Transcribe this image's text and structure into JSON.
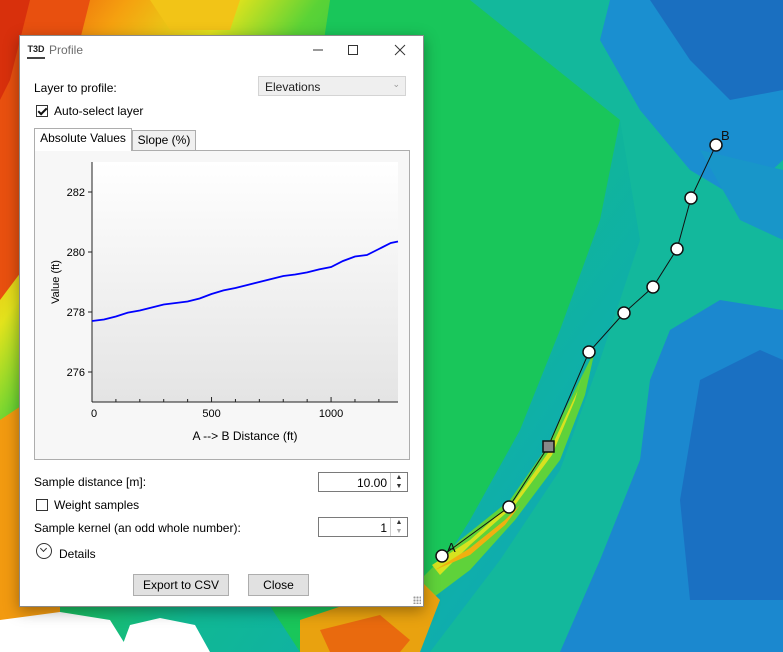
{
  "dialog": {
    "title": "Profile",
    "app_icon_text": "T3D",
    "layer_label": "Layer to profile:",
    "layer_value": "Elevations",
    "auto_select_label": "Auto-select layer",
    "auto_select_checked": true,
    "tabs": [
      {
        "label": "Absolute Values",
        "active": true
      },
      {
        "label": "Slope (%)",
        "active": false
      }
    ],
    "sample_distance_label": "Sample distance [m]:",
    "sample_distance_value": "10.00",
    "weight_samples_label": "Weight samples",
    "weight_samples_checked": false,
    "kernel_label": "Sample kernel (an odd whole number):",
    "kernel_value": "1",
    "details_label": "Details",
    "export_button": "Export to CSV",
    "close_button": "Close"
  },
  "map": {
    "point_a_label": "A",
    "point_b_label": "B",
    "colors": {
      "low_blue": "#1a7fd6",
      "teal": "#14b7a0",
      "green": "#21c640",
      "yellow": "#d9e21c",
      "orange": "#f2a10d",
      "red": "#e5410d"
    }
  },
  "chart_data": {
    "type": "line",
    "xlabel": "A --> B Distance (ft)",
    "ylabel": "Value (ft)",
    "xlim": [
      0,
      1280
    ],
    "ylim": [
      275,
      283
    ],
    "x_ticks": [
      0,
      500,
      1000
    ],
    "y_ticks": [
      276,
      278,
      280,
      282
    ],
    "series": [
      {
        "color": "#0000ff",
        "x": [
          0,
          50,
          100,
          150,
          200,
          250,
          300,
          350,
          400,
          450,
          500,
          550,
          600,
          650,
          700,
          750,
          800,
          850,
          900,
          950,
          1000,
          1050,
          1100,
          1150,
          1200,
          1250,
          1280
        ],
        "y": [
          277.7,
          277.75,
          277.85,
          277.98,
          278.05,
          278.15,
          278.25,
          278.3,
          278.35,
          278.45,
          278.6,
          278.72,
          278.8,
          278.9,
          279.0,
          279.1,
          279.2,
          279.25,
          279.32,
          279.42,
          279.5,
          279.7,
          279.85,
          279.9,
          280.1,
          280.3,
          280.35
        ]
      }
    ]
  }
}
